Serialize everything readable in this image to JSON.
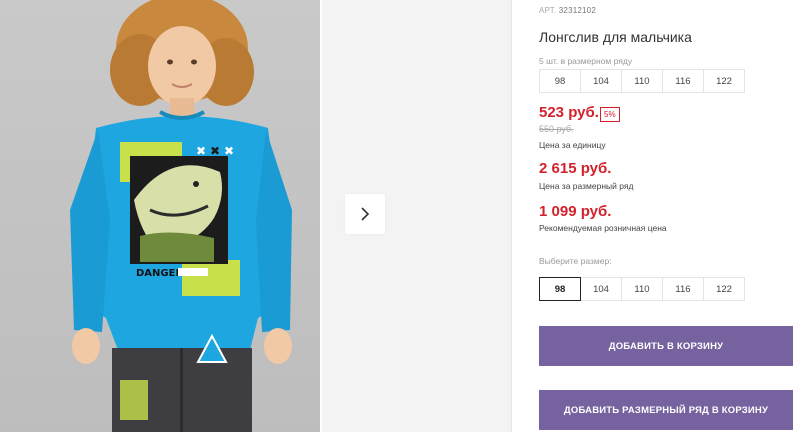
{
  "product": {
    "sku_label": "АРТ.",
    "sku": "32312102",
    "title": "Лонгслив для мальчика",
    "series_note": "5 шт. в размерном ряду",
    "series_sizes": [
      "98",
      "104",
      "110",
      "116",
      "122"
    ]
  },
  "pricing": {
    "price": "523 руб.",
    "discount": "5%",
    "old_price": "550 руб.",
    "unit_label": "Цена за единицу",
    "series_price": "2 615 руб.",
    "series_label": "Цена за размерный ряд",
    "retail_price": "1 099 руб.",
    "retail_label": "Рекомендуемая розничная цена"
  },
  "size_picker": {
    "label": "Выберите размер:",
    "options": [
      "98",
      "104",
      "110",
      "116",
      "122"
    ],
    "selected": "98"
  },
  "actions": {
    "add_to_cart": "ДОБАВИТЬ В КОРЗИНУ",
    "add_series_to_cart": "ДОБАВИТЬ РАЗМЕРНЫЙ РЯД В КОРЗИНУ"
  },
  "image_print_text": {
    "danger": "DANGER"
  },
  "colors": {
    "price_red": "#d3212c",
    "button_purple": "#75629f",
    "shirt_blue": "#1ea6e0",
    "accent_lime": "#c8e04a"
  },
  "icons": [
    "chevron-right-icon"
  ]
}
